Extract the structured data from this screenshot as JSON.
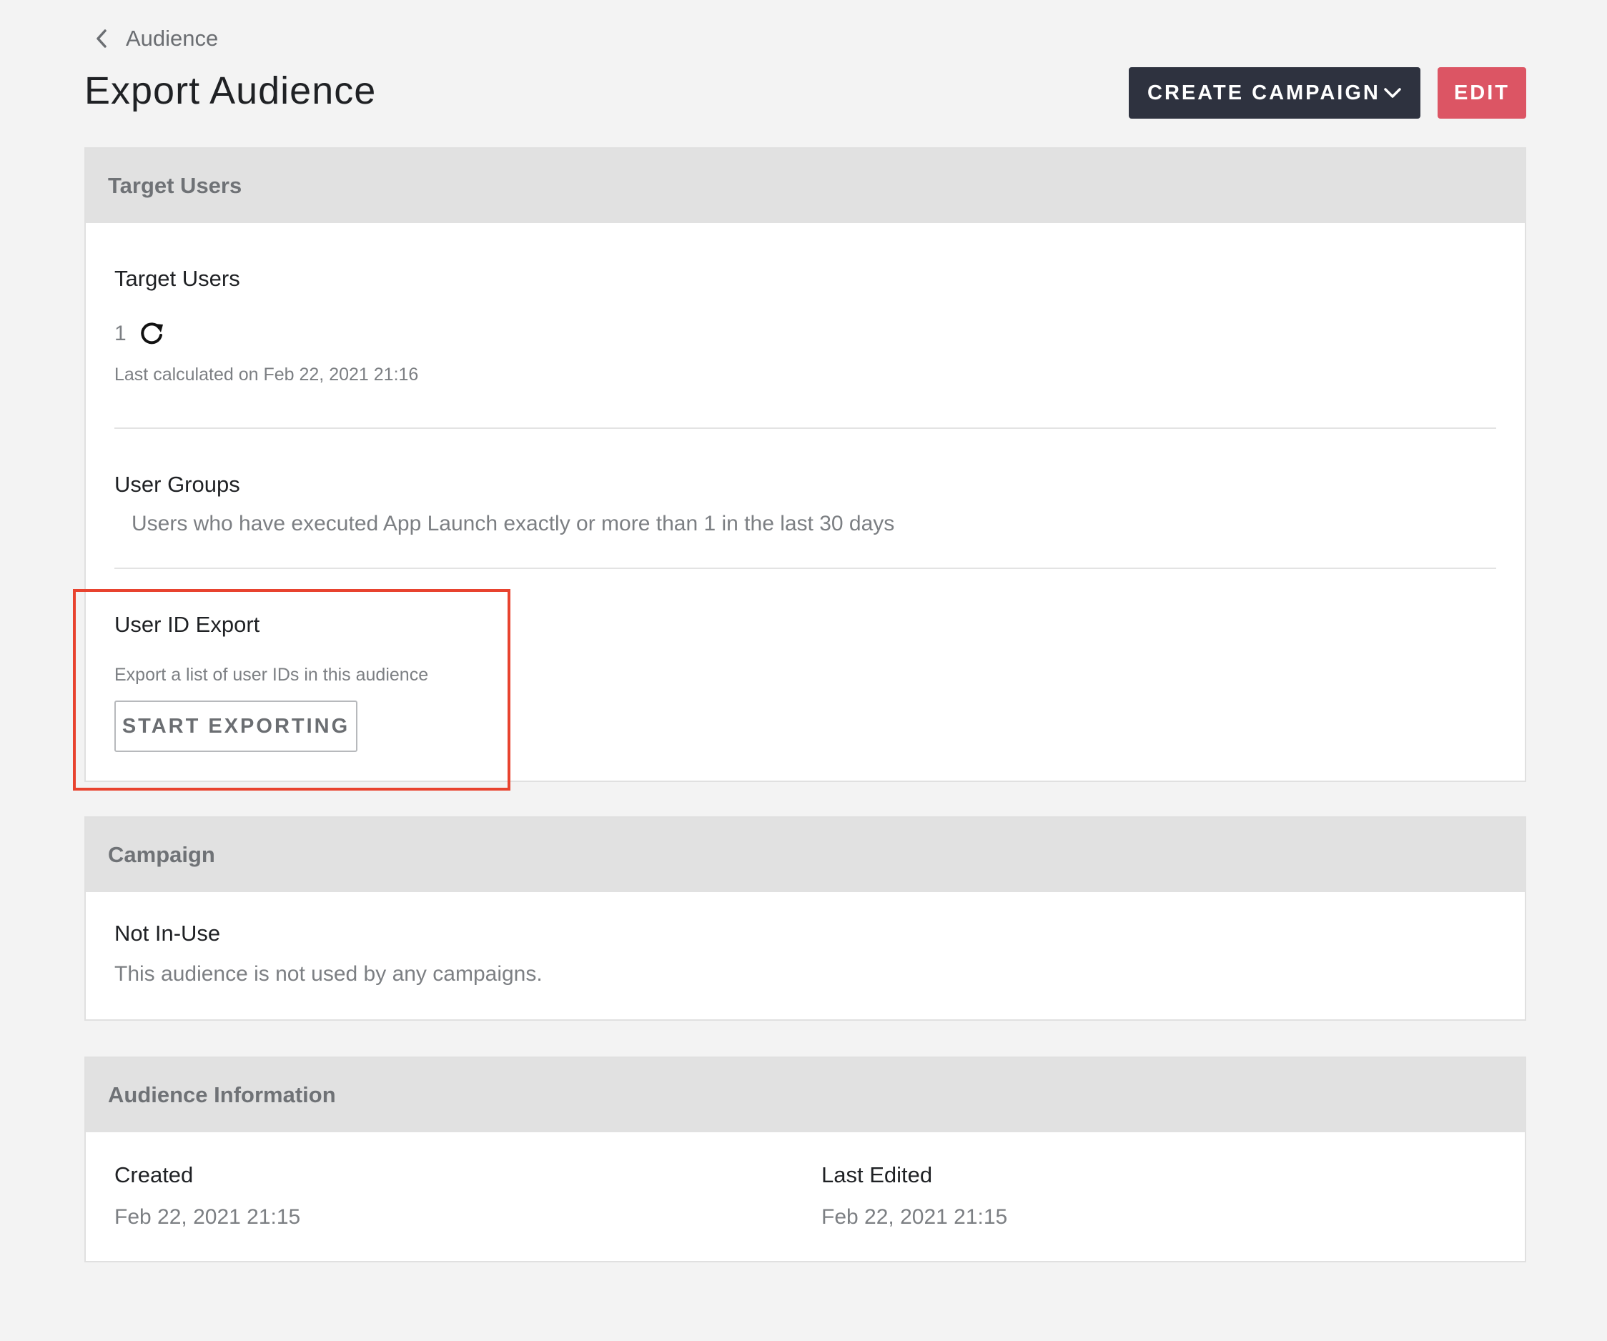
{
  "breadcrumb": {
    "label": "Audience",
    "icon": "chevron-left-icon"
  },
  "page": {
    "title": "Export Audience"
  },
  "actions": {
    "create_campaign_label": "CREATE CAMPAIGN",
    "create_campaign_icon": "chevron-down-icon",
    "edit_label": "EDIT",
    "colors": {
      "dark": "#2e323f",
      "red": "#dc5564"
    }
  },
  "target_users_card": {
    "header": "Target Users",
    "target_users": {
      "label": "Target Users",
      "count": "1",
      "refresh_icon": "refresh-icon",
      "last_calculated": "Last calculated on Feb 22, 2021 21:16"
    },
    "user_groups": {
      "label": "User Groups",
      "description": "Users who have executed App Launch exactly or more than 1 in the last 30 days"
    },
    "user_id_export": {
      "label": "User ID Export",
      "description": "Export a list of user IDs in this audience",
      "button_label": "START EXPORTING",
      "highlight_color": "#e8432f"
    }
  },
  "campaign_card": {
    "header": "Campaign",
    "status": "Not In-Use",
    "description": "This audience is not used by any campaigns."
  },
  "info_card": {
    "header": "Audience Information",
    "created_label": "Created",
    "created_value": "Feb 22, 2021 21:15",
    "last_edited_label": "Last Edited",
    "last_edited_value": "Feb 22, 2021 21:15"
  }
}
